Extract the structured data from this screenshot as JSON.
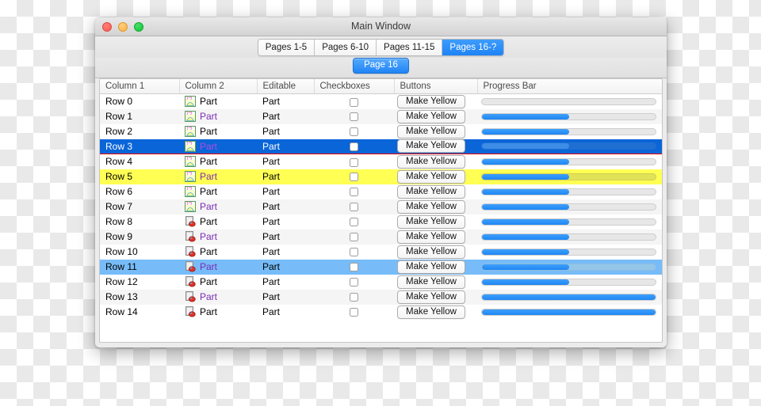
{
  "window": {
    "title": "Main Window",
    "controls": {
      "close": "close-button",
      "minimize": "minimize-button",
      "zoom": "zoom-button"
    }
  },
  "tabs": [
    {
      "label": "Pages 1-5",
      "active": false
    },
    {
      "label": "Pages 6-10",
      "active": false
    },
    {
      "label": "Pages 11-15",
      "active": false
    },
    {
      "label": "Pages 16-?",
      "active": true
    }
  ],
  "page_button": {
    "label": "Page 16"
  },
  "table": {
    "headers": [
      "Column 1",
      "Column 2",
      "Editable",
      "Checkboxes",
      "Buttons",
      "Progress Bar"
    ],
    "button_label": "Make Yellow",
    "part_label": "Part",
    "rows": [
      {
        "col1": "Row 0",
        "col2": "Part",
        "col2_purple": false,
        "editable": "Part",
        "checked": false,
        "button": "Make Yellow",
        "progress": 0,
        "icon": "chart-yellow-icon",
        "state": "normal"
      },
      {
        "col1": "Row 1",
        "col2": "Part",
        "col2_purple": true,
        "editable": "Part",
        "checked": false,
        "button": "Make Yellow",
        "progress": 50,
        "icon": "chart-yellow-icon",
        "state": "alt"
      },
      {
        "col1": "Row 2",
        "col2": "Part",
        "col2_purple": false,
        "editable": "Part",
        "checked": false,
        "button": "Make Yellow",
        "progress": 50,
        "icon": "chart-yellow-icon",
        "state": "normal"
      },
      {
        "col1": "Row 3",
        "col2": "Part",
        "col2_purple": true,
        "editable": "Part",
        "checked": false,
        "button": "Make Yellow",
        "progress": 50,
        "icon": "chart-yellow-icon",
        "state": "selected"
      },
      {
        "col1": "Row 4",
        "col2": "Part",
        "col2_purple": false,
        "editable": "Part",
        "checked": false,
        "button": "Make Yellow",
        "progress": 50,
        "icon": "chart-yellow-icon",
        "state": "normal"
      },
      {
        "col1": "Row 5",
        "col2": "Part",
        "col2_purple": true,
        "editable": "Part",
        "checked": false,
        "button": "Make Yellow",
        "progress": 50,
        "icon": "chart-yellow-icon",
        "state": "yellow"
      },
      {
        "col1": "Row 6",
        "col2": "Part",
        "col2_purple": false,
        "editable": "Part",
        "checked": false,
        "button": "Make Yellow",
        "progress": 50,
        "icon": "chart-yellow-icon",
        "state": "normal"
      },
      {
        "col1": "Row 7",
        "col2": "Part",
        "col2_purple": true,
        "editable": "Part",
        "checked": false,
        "button": "Make Yellow",
        "progress": 50,
        "icon": "chart-yellow-icon",
        "state": "alt"
      },
      {
        "col1": "Row 8",
        "col2": "Part",
        "col2_purple": false,
        "editable": "Part",
        "checked": false,
        "button": "Make Yellow",
        "progress": 50,
        "icon": "document-red-badge-icon",
        "state": "normal"
      },
      {
        "col1": "Row 9",
        "col2": "Part",
        "col2_purple": true,
        "editable": "Part",
        "checked": false,
        "button": "Make Yellow",
        "progress": 50,
        "icon": "document-red-badge-icon",
        "state": "alt"
      },
      {
        "col1": "Row 10",
        "col2": "Part",
        "col2_purple": false,
        "editable": "Part",
        "checked": false,
        "button": "Make Yellow",
        "progress": 50,
        "icon": "document-red-badge-icon",
        "state": "normal"
      },
      {
        "col1": "Row 11",
        "col2": "Part",
        "col2_purple": true,
        "editable": "Part",
        "checked": false,
        "button": "Make Yellow",
        "progress": 50,
        "icon": "document-red-badge-icon",
        "state": "lightblue"
      },
      {
        "col1": "Row 12",
        "col2": "Part",
        "col2_purple": false,
        "editable": "Part",
        "checked": false,
        "button": "Make Yellow",
        "progress": 50,
        "icon": "document-red-badge-icon",
        "state": "normal"
      },
      {
        "col1": "Row 13",
        "col2": "Part",
        "col2_purple": true,
        "editable": "Part",
        "checked": false,
        "button": "Make Yellow",
        "progress": 100,
        "icon": "document-red-badge-icon",
        "state": "alt"
      },
      {
        "col1": "Row 14",
        "col2": "Part",
        "col2_purple": false,
        "editable": "Part",
        "checked": false,
        "button": "Make Yellow",
        "progress": 100,
        "icon": "document-red-badge-icon",
        "state": "normal"
      }
    ]
  },
  "colors": {
    "accent_blue": "#1f84f6",
    "selection_blue": "#0a65d8",
    "selection_underline_red": "#f40000",
    "highlight_yellow": "#ffff54",
    "highlight_lightblue": "#77bcf8",
    "part_purple": "#7a2ab4",
    "traffic_red": "#fb5a51",
    "traffic_yellow": "#fbb040",
    "traffic_green": "#0fc230"
  }
}
